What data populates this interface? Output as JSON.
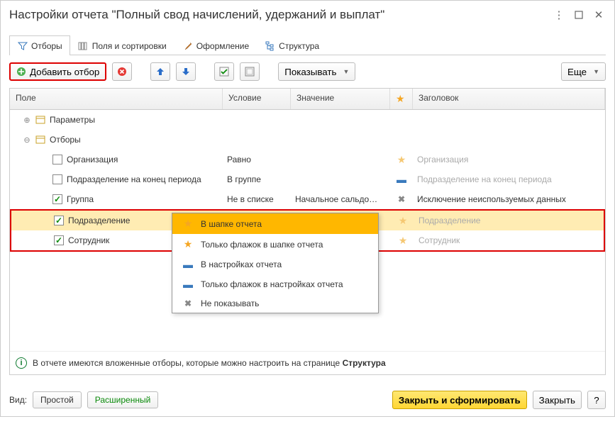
{
  "title": "Настройки отчета \"Полный свод начислений, удержаний и выплат\"",
  "tabs": {
    "filters": "Отборы",
    "fields": "Поля и сортировки",
    "format": "Оформление",
    "structure": "Структура"
  },
  "toolbar": {
    "add_filter": "Добавить отбор",
    "show": "Показывать",
    "more": "Еще"
  },
  "columns": {
    "field": "Поле",
    "condition": "Условие",
    "value": "Значение",
    "title": "Заголовок"
  },
  "tree": {
    "params": "Параметры",
    "filters": "Отборы",
    "rows": [
      {
        "checked": false,
        "field": "Организация",
        "cond": "Равно",
        "value": "",
        "star": "star",
        "title": "Организация",
        "titleMuted": true
      },
      {
        "checked": false,
        "field": "Подразделение на конец периода",
        "cond": "В группе",
        "value": "",
        "star": "dash",
        "title": "Подразделение на конец периода",
        "titleMuted": true
      },
      {
        "checked": true,
        "field": "Группа",
        "cond": "Не в списке",
        "value": "Начальное сальдо…",
        "star": "x",
        "title": "Исключение неиспользуемых данных",
        "titleMuted": false
      },
      {
        "checked": true,
        "field": "Подразделение",
        "cond": "",
        "value": "",
        "star": "star",
        "title": "Подразделение",
        "titleMuted": true,
        "highlighted": true,
        "selected": true
      },
      {
        "checked": true,
        "field": "Сотрудник",
        "cond": "",
        "value": "",
        "star": "star",
        "title": "Сотрудник",
        "titleMuted": true,
        "highlighted": true
      }
    ]
  },
  "dropdown": {
    "items": [
      {
        "icon": "star",
        "label": "В шапке отчета",
        "selected": true
      },
      {
        "icon": "star",
        "label": "Только флажок в шапке отчета"
      },
      {
        "icon": "dash",
        "label": "В настройках отчета"
      },
      {
        "icon": "dash",
        "label": "Только флажок в настройках отчета"
      },
      {
        "icon": "x",
        "label": "Не показывать"
      }
    ]
  },
  "info": {
    "text_a": "В отчете имеются вложенные отборы, которые можно настроить на странице ",
    "text_b": "Структура"
  },
  "footer": {
    "view_label": "Вид:",
    "simple": "Простой",
    "advanced": "Расширенный",
    "close_and_form": "Закрыть и сформировать",
    "close": "Закрыть",
    "help": "?"
  }
}
